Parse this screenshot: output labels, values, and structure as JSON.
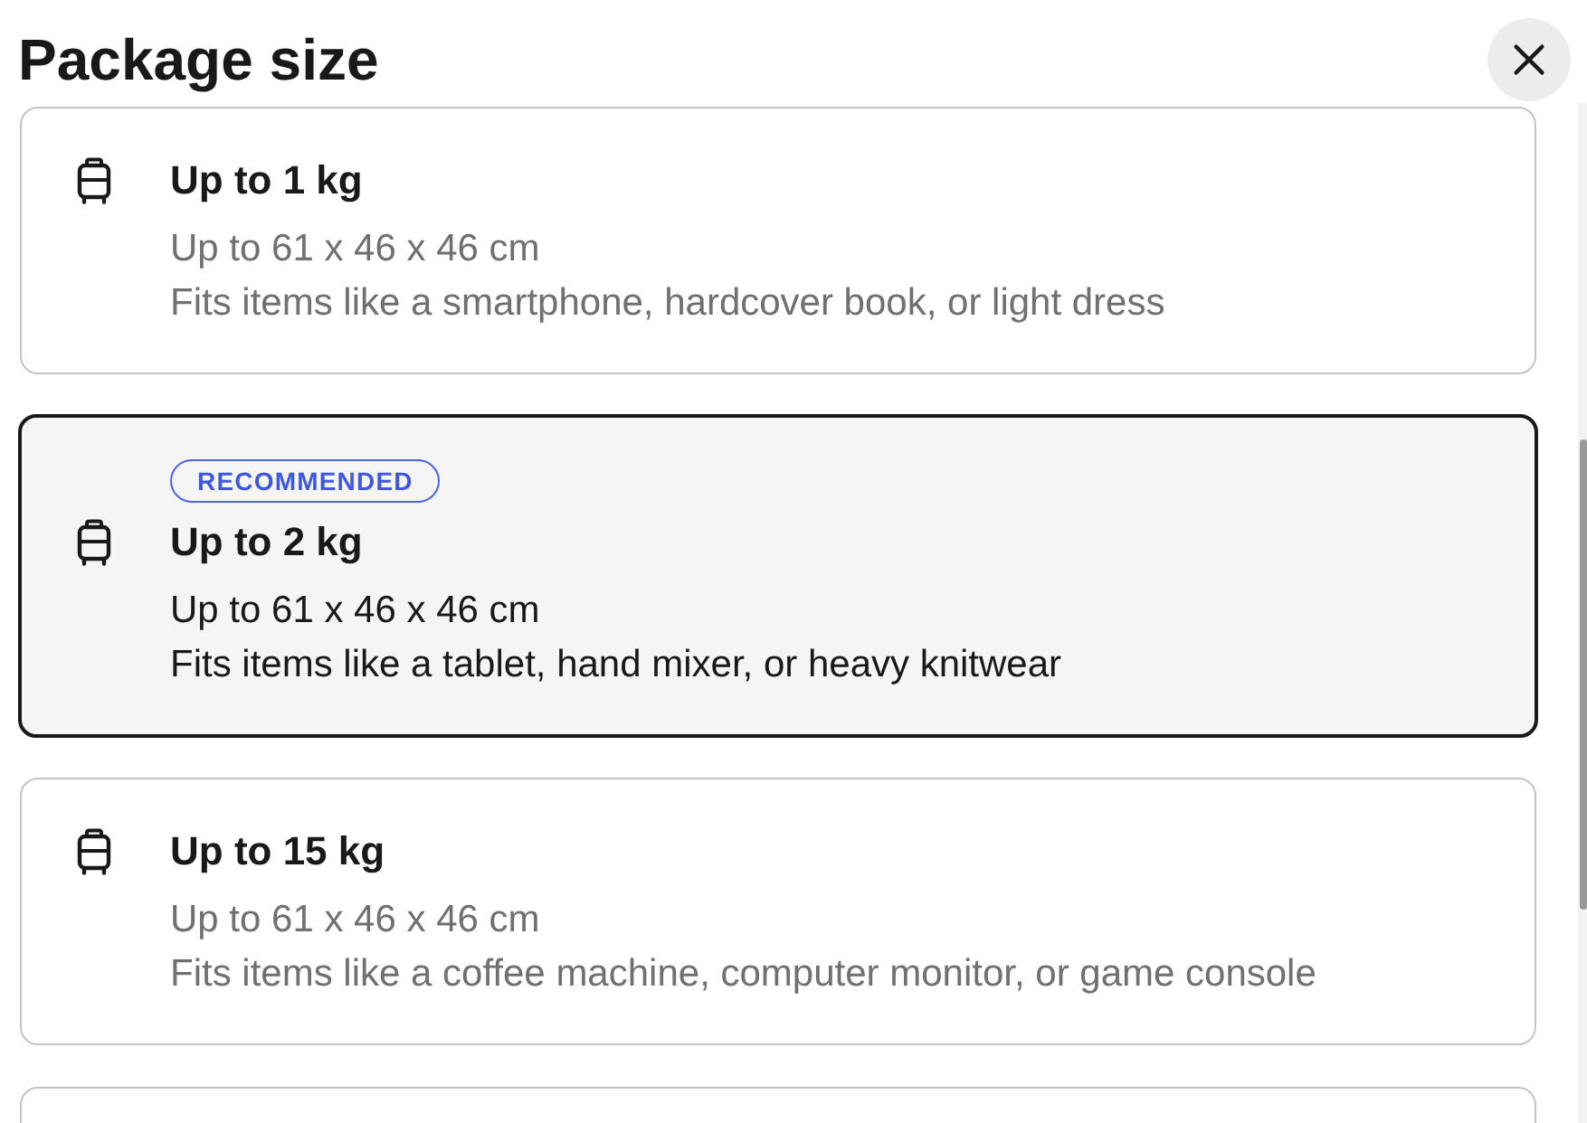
{
  "title": "Package size",
  "options": [
    {
      "weight": "Up to 1 kg",
      "dimensions": "Up to 61 x 46 x 46 cm",
      "description": "Fits items like a smartphone, hardcover book, or light dress",
      "selected": false
    },
    {
      "badge": "RECOMMENDED",
      "weight": "Up to 2 kg",
      "dimensions": "Up to 61 x 46 x 46 cm",
      "description": "Fits items like a tablet, hand mixer, or heavy knitwear",
      "selected": true
    },
    {
      "weight": "Up to 15 kg",
      "dimensions": "Up to 61 x 46 x 46 cm",
      "description": "Fits items like a coffee machine, computer monitor, or game console",
      "selected": false
    },
    {
      "selected": false
    }
  ]
}
